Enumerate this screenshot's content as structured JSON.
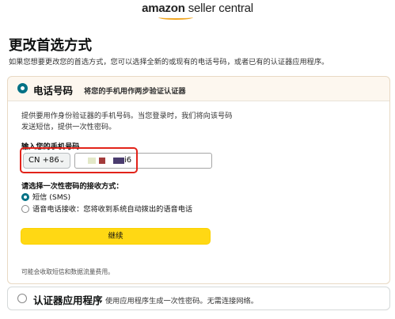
{
  "header": {
    "logo_brand": "amazon",
    "logo_product": "seller central"
  },
  "page": {
    "title": "更改首选方式",
    "description": "如果您想要更改您的首选方式，您可以选择全新的或现有的电话号码，或者已有的认证器应用程序。"
  },
  "phone_option": {
    "title": "电话号码",
    "subtitle": "将您的手机用作两步验证认证器",
    "selected": true,
    "description": "提供要用作身份验证器的手机号码。当您登录时，我们将向该号码发送短信，提供一次性密码。",
    "phone_label": "输入您的手机号码",
    "country_code": "CN +86",
    "phone_value_suffix": "i6",
    "receive_label": "请选择一次性密码的接收方式：",
    "receive_options": [
      {
        "label": "短信 (SMS)",
        "selected": true
      },
      {
        "label": "语音电话接收：您将收到系统自动拨出的语音电话",
        "selected": false
      }
    ],
    "continue_label": "继续",
    "fee_note": "可能会收取短信和数据流量费用。"
  },
  "app_option": {
    "title": "认证器应用程序",
    "subtitle": "使用应用程序生成一次性密码。无需连接网络。",
    "selected": false
  },
  "colors": {
    "accent": "#007185",
    "button": "#ffd814",
    "highlight": "#e2231a",
    "logo_smile": "#f0a520"
  }
}
